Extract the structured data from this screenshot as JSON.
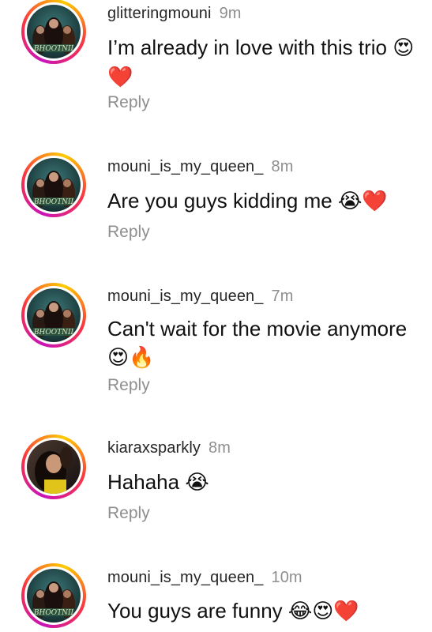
{
  "comments": [
    {
      "username": "glitteringmouni",
      "time": "9m",
      "text": "I’m already in love with this trio",
      "emojis": "😍 ❤️",
      "reply_label": "Reply",
      "avatar_text": "BHOOTNII"
    },
    {
      "username": "mouni_is_my_queen_",
      "time": "8m",
      "text": "Are you guys kidding me",
      "emojis": "😭❤️",
      "reply_label": "Reply",
      "avatar_text": "BHOOTNII"
    },
    {
      "username": "mouni_is_my_queen_",
      "time": "7m",
      "text": "Can't wait for the movie anymore",
      "emojis": "😍🔥",
      "reply_label": "Reply",
      "avatar_text": "BHOOTNII"
    },
    {
      "username": "kiaraxsparkly",
      "time": "8m",
      "text": "Hahaha",
      "emojis": "😭",
      "reply_label": "Reply"
    },
    {
      "username": "mouni_is_my_queen_",
      "time": "10m",
      "text": "You guys are funny",
      "emojis": "😂😍❤️",
      "avatar_text": "BHOOTNII"
    }
  ],
  "colors": {
    "username": "#262626",
    "timestamp": "#8e8e8e",
    "reply": "#8e8e8e",
    "story_ring": [
      "#c913b9",
      "#f9373f",
      "#fecd00"
    ]
  }
}
